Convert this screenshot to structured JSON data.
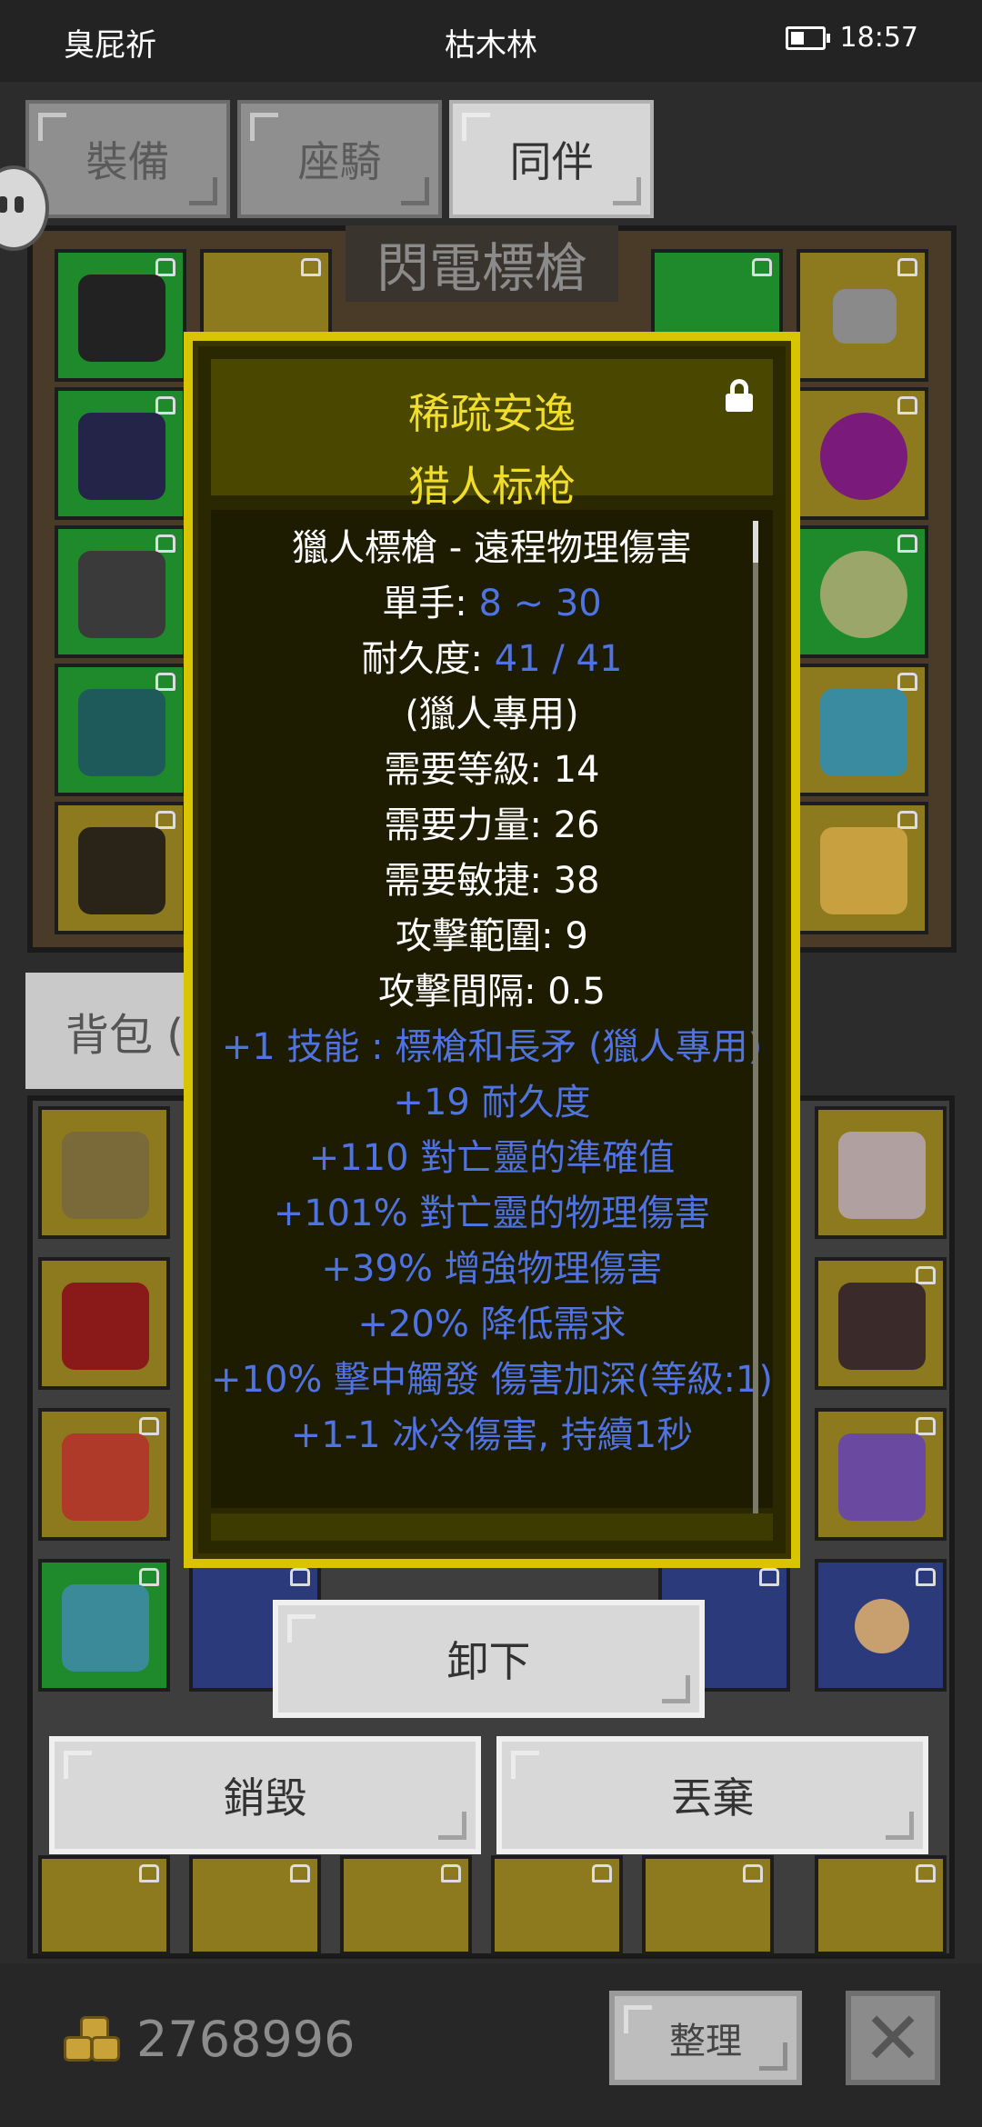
{
  "status_bar": {
    "left": "臭屁祈",
    "center": "枯木林",
    "time": "18:57"
  },
  "tabs": [
    {
      "label": "裝備",
      "active": false
    },
    {
      "label": "座騎",
      "active": false
    },
    {
      "label": "同伴",
      "active": true
    }
  ],
  "equipment_panel": {
    "banner": "閃電標槍"
  },
  "backpack": {
    "tab_label": "背包 ("
  },
  "tooltip": {
    "title_line1": "稀疏安逸",
    "title_line2": "猎人标枪",
    "lines": [
      {
        "text": "獵人標槍 - 遠程物理傷害"
      },
      {
        "label": "單手: ",
        "value": "8 ~ 30"
      },
      {
        "label": "耐久度: ",
        "value": "41 / 41"
      },
      {
        "text": "(獵人專用)"
      },
      {
        "text": "需要等級: 14"
      },
      {
        "text": "需要力量: 26"
      },
      {
        "text": "需要敏捷: 38"
      },
      {
        "text": "攻擊範圍: 9"
      },
      {
        "text": "攻擊間隔: 0.5"
      },
      {
        "blue": "+1 技能 : 標槍和長矛 (獵人專用)"
      },
      {
        "blue": "+19 耐久度"
      },
      {
        "blue": "+110 對亡靈的準確值"
      },
      {
        "blue": "+101% 對亡靈的物理傷害"
      },
      {
        "blue": "+39% 增強物理傷害"
      },
      {
        "blue": "+20% 降低需求"
      },
      {
        "blue": "+10% 擊中觸發 傷害加深(等級:1)"
      },
      {
        "blue": "+1-1 冰冷傷害, 持續1秒"
      }
    ]
  },
  "buttons": {
    "unequip": "卸下",
    "destroy": "銷毀",
    "drop": "丟棄",
    "sort": "整理",
    "close": "✕"
  },
  "footer": {
    "gold": "2768996"
  },
  "colors": {
    "tooltip_border": "#d8c400",
    "tooltip_title": "#f1de2c",
    "stat_blue": "#4f73e2"
  }
}
